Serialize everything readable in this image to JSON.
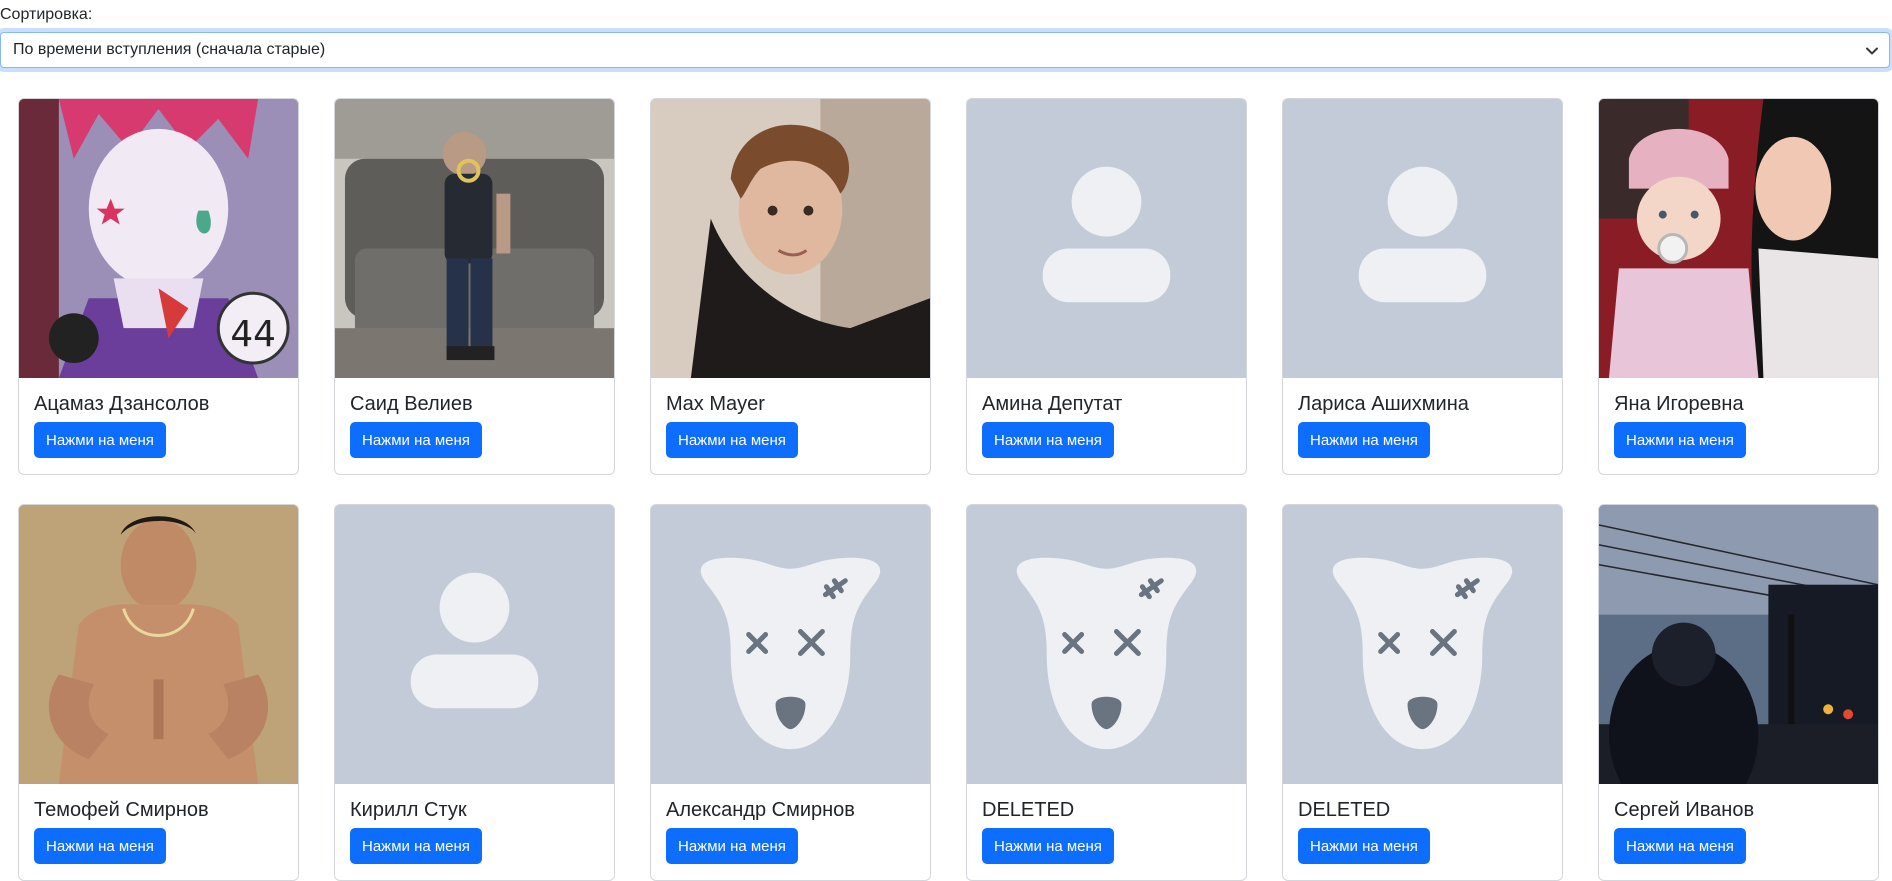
{
  "sort": {
    "label": "Сортировка:",
    "selected": "По времени вступления (сначала старые)"
  },
  "button_label": "Нажми на меня",
  "members": [
    {
      "name": "Ацамаз Дзансолов",
      "avatar": "photo-anime"
    },
    {
      "name": "Саид Велиев",
      "avatar": "photo-sofa"
    },
    {
      "name": "Max Mayer",
      "avatar": "photo-portrait"
    },
    {
      "name": "Амина Депутат",
      "avatar": "no-photo"
    },
    {
      "name": "Лариса Ашихмина",
      "avatar": "no-photo"
    },
    {
      "name": "Яна Игоревна",
      "avatar": "photo-mother-child"
    },
    {
      "name": "Темофей Смирнов",
      "avatar": "photo-shirtless"
    },
    {
      "name": "Кирилл Стук",
      "avatar": "no-photo"
    },
    {
      "name": "Александр Смирнов",
      "avatar": "deleted-dog"
    },
    {
      "name": "DELETED",
      "avatar": "deleted-dog"
    },
    {
      "name": "DELETED",
      "avatar": "deleted-dog"
    },
    {
      "name": "Сергей Иванов",
      "avatar": "photo-night-street"
    }
  ],
  "colors": {
    "accent": "#0d6efd",
    "placeholder_bg": "#c4cbd8",
    "placeholder_fg": "#eef0f4"
  }
}
